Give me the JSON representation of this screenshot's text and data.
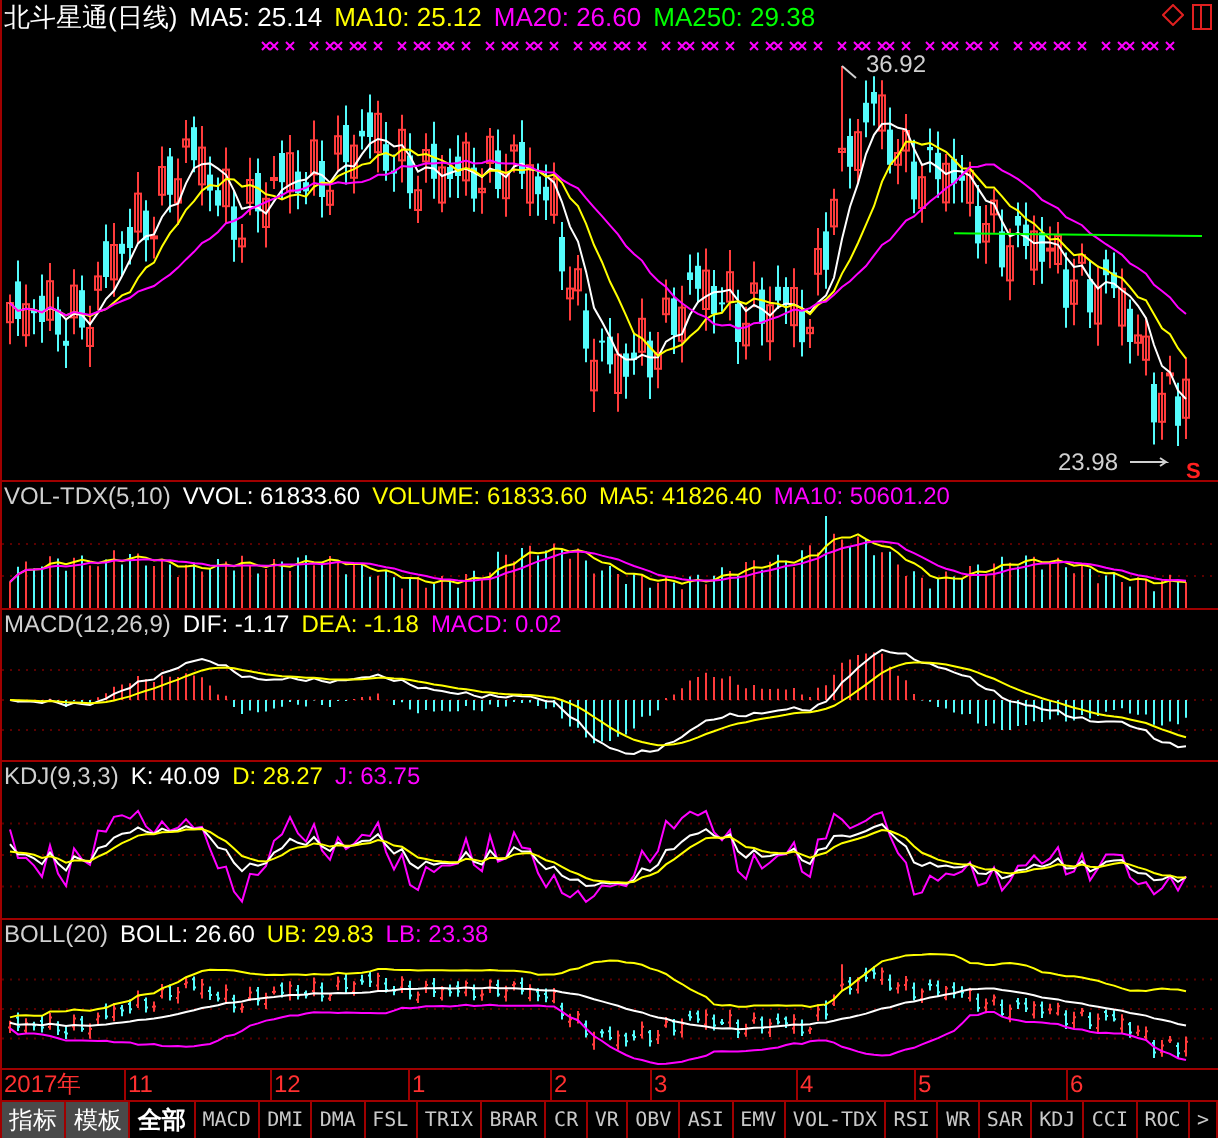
{
  "main_panel": {
    "kind": "candlestick",
    "title": "北斗星通(日线)",
    "values": [
      {
        "label": "MA5: 25.14",
        "color": "#ffffff"
      },
      {
        "label": "MA10: 25.12",
        "color": "#ffff00"
      },
      {
        "label": "MA20: 26.60",
        "color": "#ff00ff"
      },
      {
        "label": "MA250: 29.38",
        "color": "#00ff00"
      }
    ],
    "high_label": "36.92",
    "low_label": "23.98",
    "signal_mark": "S"
  },
  "panels": [
    {
      "kind": "volume",
      "title": "VOL-TDX(5,10)",
      "values": [
        {
          "label": "VVOL: 61833.60",
          "color": "#ffffff"
        },
        {
          "label": "VOLUME: 61833.60",
          "color": "#ffff00"
        },
        {
          "label": "MA5: 41826.40",
          "color": "#ffff00"
        },
        {
          "label": "MA10: 50601.20",
          "color": "#ff00ff"
        }
      ]
    },
    {
      "kind": "macd",
      "title": "MACD(12,26,9)",
      "values": [
        {
          "label": "DIF: -1.17",
          "color": "#ffffff"
        },
        {
          "label": "DEA: -1.18",
          "color": "#ffff00"
        },
        {
          "label": "MACD: 0.02",
          "color": "#ff00ff"
        }
      ]
    },
    {
      "kind": "kdj",
      "title": "KDJ(9,3,3)",
      "values": [
        {
          "label": "K: 40.09",
          "color": "#ffffff"
        },
        {
          "label": "D: 28.27",
          "color": "#ffff00"
        },
        {
          "label": "J: 63.75",
          "color": "#ff00ff"
        }
      ]
    },
    {
      "kind": "boll",
      "title": "BOLL(20)",
      "values": [
        {
          "label": "BOLL: 26.60",
          "color": "#ffffff"
        },
        {
          "label": "UB: 29.83",
          "color": "#ffff00"
        },
        {
          "label": "LB: 23.38",
          "color": "#ff00ff"
        }
      ]
    }
  ],
  "date_axis": [
    "2017年",
    "11",
    "12",
    "1",
    "2",
    "3",
    "4",
    "5",
    "6"
  ],
  "tabs": [
    {
      "label": "指标",
      "kind": "menu",
      "selected": false
    },
    {
      "label": "模板",
      "kind": "menu",
      "selected": false
    },
    {
      "label": "全部",
      "kind": "indicator",
      "selected": true
    },
    {
      "label": "MACD",
      "kind": "indicator",
      "selected": false
    },
    {
      "label": "DMI",
      "kind": "indicator",
      "selected": false
    },
    {
      "label": "DMA",
      "kind": "indicator",
      "selected": false
    },
    {
      "label": "FSL",
      "kind": "indicator",
      "selected": false
    },
    {
      "label": "TRIX",
      "kind": "indicator",
      "selected": false
    },
    {
      "label": "BRAR",
      "kind": "indicator",
      "selected": false
    },
    {
      "label": "CR",
      "kind": "indicator",
      "selected": false
    },
    {
      "label": "VR",
      "kind": "indicator",
      "selected": false
    },
    {
      "label": "OBV",
      "kind": "indicator",
      "selected": false
    },
    {
      "label": "ASI",
      "kind": "indicator",
      "selected": false
    },
    {
      "label": "EMV",
      "kind": "indicator",
      "selected": false
    },
    {
      "label": "VOL-TDX",
      "kind": "indicator",
      "selected": false
    },
    {
      "label": "RSI",
      "kind": "indicator",
      "selected": false
    },
    {
      "label": "WR",
      "kind": "indicator",
      "selected": false
    },
    {
      "label": "SAR",
      "kind": "indicator",
      "selected": false
    },
    {
      "label": "KDJ",
      "kind": "indicator",
      "selected": false
    },
    {
      "label": "CCI",
      "kind": "indicator",
      "selected": false
    },
    {
      "label": "ROC",
      "kind": "indicator",
      "selected": false
    },
    {
      "label": ">",
      "kind": "arrow",
      "selected": false
    }
  ]
}
